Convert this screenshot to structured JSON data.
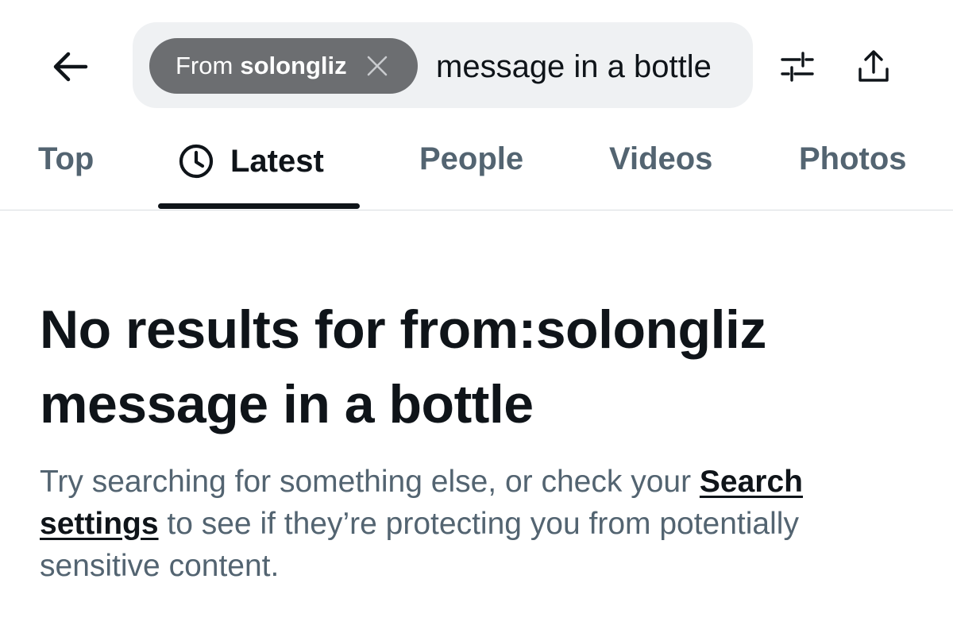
{
  "search": {
    "filter_prefix": "From",
    "filter_user": "solongliz",
    "query": "message in a bottle"
  },
  "icons": {
    "back": "arrow-left-icon",
    "chip_close": "x-icon",
    "filter": "sliders-icon",
    "share": "share-upload-icon",
    "active_tab": "clock-icon"
  },
  "tabs": [
    {
      "label": "Top",
      "active": false
    },
    {
      "label": "Latest",
      "active": true
    },
    {
      "label": "People",
      "active": false
    },
    {
      "label": "Videos",
      "active": false
    },
    {
      "label": "Photos",
      "active": false
    }
  ],
  "empty_state": {
    "title_prefix": "No results for ",
    "title_query": "from:solongliz message in a bottle",
    "body_before": "Try searching for something else, or check your ",
    "link": "Search settings",
    "body_after": " to see if they’re protecting you from potentially sensitive content."
  },
  "colors": {
    "text_primary": "#0f1419",
    "text_secondary": "#536471",
    "chip_background": "#6c6e71",
    "search_background": "#eff1f3",
    "divider": "#d9dde1"
  }
}
